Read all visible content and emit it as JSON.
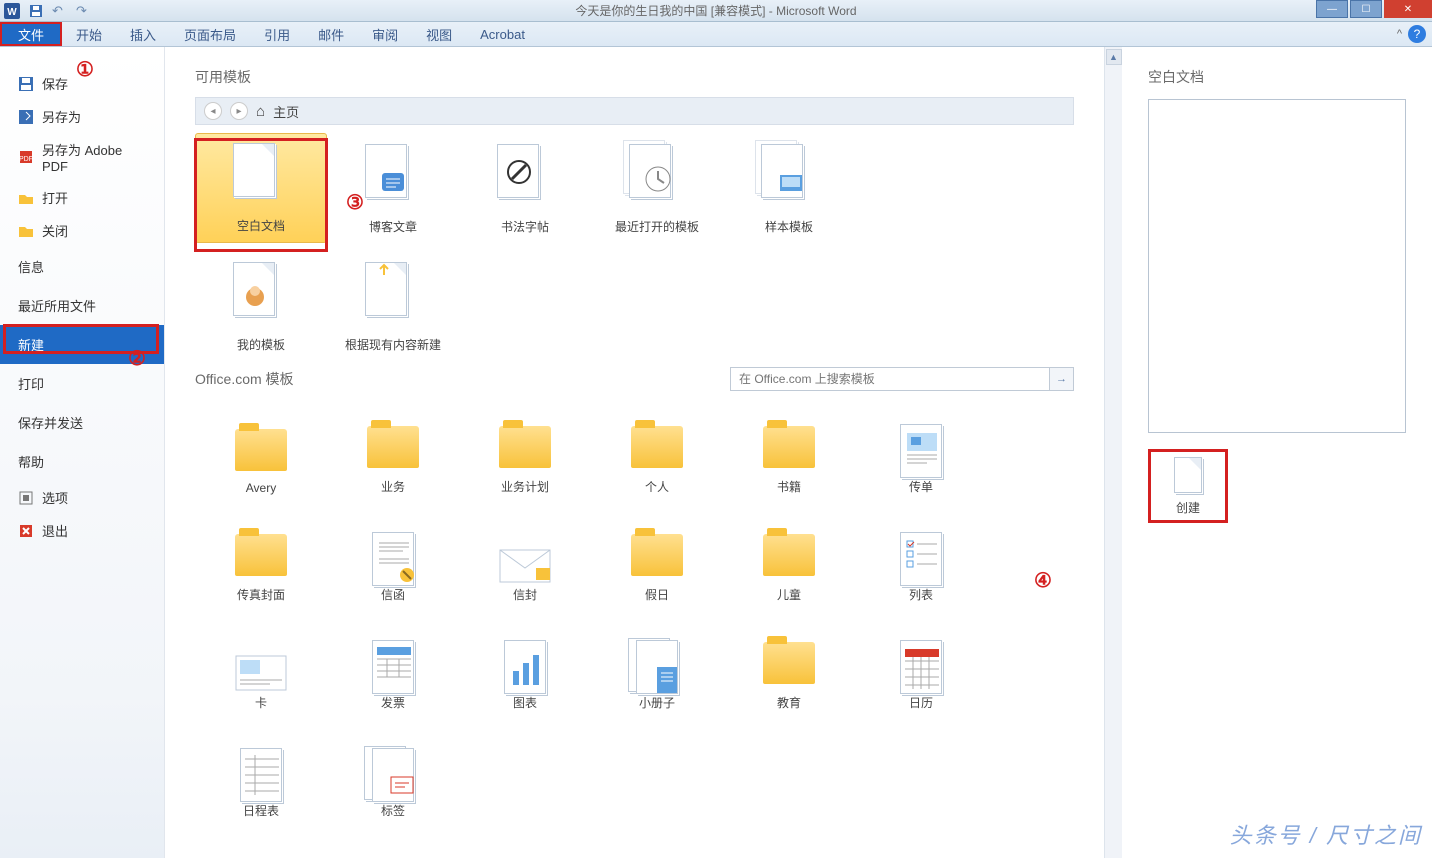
{
  "title": "今天是你的生日我的中国 [兼容模式] - Microsoft Word",
  "ribbon": {
    "file": "文件",
    "tabs": [
      "开始",
      "插入",
      "页面布局",
      "引用",
      "邮件",
      "审阅",
      "视图",
      "Acrobat"
    ]
  },
  "sidebar": {
    "save": "保存",
    "save_as": "另存为",
    "save_pdf": "另存为 Adobe PDF",
    "open": "打开",
    "close": "关闭",
    "info": "信息",
    "recent": "最近所用文件",
    "new": "新建",
    "print": "打印",
    "save_send": "保存并发送",
    "help": "帮助",
    "options": "选项",
    "exit": "退出"
  },
  "templates": {
    "heading": "可用模板",
    "home": "主页",
    "row1": [
      {
        "label": "空白文档",
        "type": "blank",
        "selected": true
      },
      {
        "label": "博客文章",
        "type": "blog"
      },
      {
        "label": "书法字帖",
        "type": "calligraphy"
      },
      {
        "label": "最近打开的模板",
        "type": "recent"
      },
      {
        "label": "样本模板",
        "type": "sample"
      }
    ],
    "row2": [
      {
        "label": "我的模板",
        "type": "mytmpl"
      },
      {
        "label": "根据现有内容新建",
        "type": "fromexisting"
      }
    ],
    "office_heading": "Office.com 模板",
    "search_placeholder": "在 Office.com 上搜索模板",
    "office": [
      "Avery",
      "业务",
      "业务计划",
      "个人",
      "书籍",
      "传单",
      "传真封面",
      "信函",
      "信封",
      "假日",
      "儿童",
      "列表",
      "卡",
      "发票",
      "图表",
      "小册子",
      "教育",
      "日历",
      "日程表",
      "标签"
    ],
    "office_types": [
      "folder",
      "folder",
      "folder",
      "folder",
      "folder",
      "flyer",
      "folder",
      "letter",
      "envelope",
      "folder",
      "folder",
      "list",
      "card",
      "invoice",
      "chart",
      "booklet",
      "folder",
      "calendar",
      "schedule",
      "label"
    ]
  },
  "preview": {
    "heading": "空白文档",
    "create": "创建"
  },
  "annotations": {
    "a1": "①",
    "a2": "②",
    "a3": "③",
    "a4": "④"
  },
  "watermark": {
    "main": "头条号 / 尺寸之间",
    "sub": ""
  }
}
